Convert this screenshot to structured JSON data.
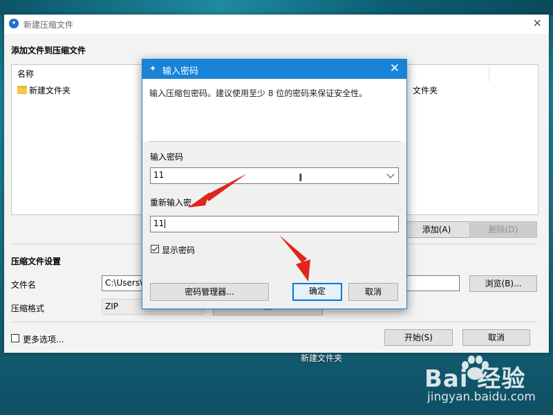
{
  "main_window": {
    "title": "新建压缩文件",
    "add_section_title": "添加文件到压缩文件",
    "file_list": {
      "column_name": "名称",
      "items": [
        {
          "name": "新建文件夹",
          "icon": "folder-icon"
        }
      ],
      "obscured_text": "文件夹"
    },
    "add_button": "添加(A)",
    "delete_button": "删除(D)",
    "settings_title": "压缩文件设置",
    "filename_label": "文件名",
    "filename_value": "C:\\Users\\",
    "browse_button": "浏览(B)...",
    "format_label": "压缩格式",
    "format_value": "ZIP",
    "hidden_button_text": "...",
    "more_options_label": "更多选项...",
    "start_button": "开始(S)",
    "cancel_button": "取消"
  },
  "password_dialog": {
    "title": "输入密码",
    "description": "输入压缩包密码。建议使用至少 8 位的密码来保证安全性。",
    "password_label": "输入密码",
    "password_value": "11",
    "confirm_label": "重新输入密",
    "confirm_value": "11",
    "show_password_label": "显示密码",
    "show_password_checked": true,
    "manager_button": "密码管理器...",
    "ok_button": "确定",
    "cancel_button": "取消",
    "accent_color": "#1883d7"
  },
  "desktop": {
    "icon_label": "新建文件夹"
  },
  "watermark": {
    "logo_text": "Bai 经验",
    "url": "jingyan.baidu.com"
  },
  "annotations": {
    "arrow_color": "#e0261c"
  }
}
